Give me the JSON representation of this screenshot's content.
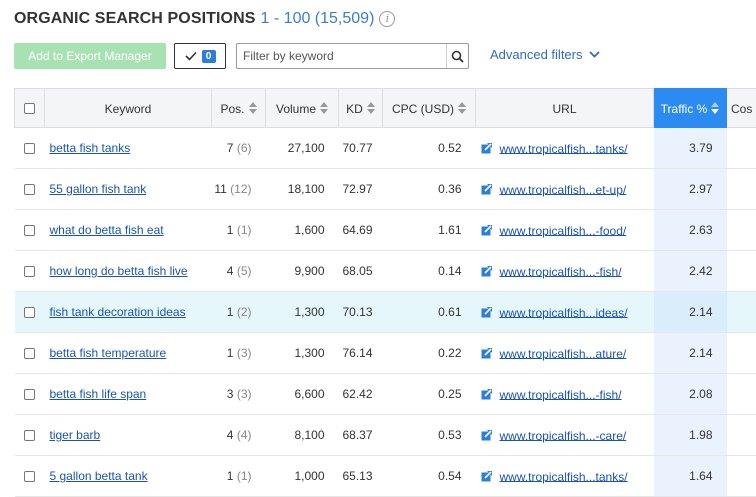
{
  "header": {
    "title": "ORGANIC SEARCH POSITIONS",
    "range": "1 - 100 (15,509)",
    "info_icon": "info-icon"
  },
  "toolbar": {
    "export_label": "Add to Export Manager",
    "selected_count": "0",
    "filter_placeholder": "Filter by keyword",
    "advanced_filters_label": "Advanced filters"
  },
  "colors": {
    "export_button": "#a8e2b2",
    "active_header": "#2b8bf0",
    "link": "#1a54b0",
    "highlight_row": "#e6f7fc"
  },
  "columns": {
    "keyword": "Keyword",
    "pos": "Pos.",
    "volume": "Volume",
    "kd": "KD",
    "cpc": "CPC (USD)",
    "url": "URL",
    "traffic": "Traffic %",
    "cost": "Cos"
  },
  "rows": [
    {
      "keyword": "betta fish tanks",
      "pos": "7",
      "prev": "(6)",
      "volume": "27,100",
      "kd": "70.77",
      "cpc": "0.52",
      "url": "www.tropicalfish...tanks/",
      "traffic": "3.79"
    },
    {
      "keyword": "55 gallon fish tank",
      "pos": "11",
      "prev": "(12)",
      "volume": "18,100",
      "kd": "72.97",
      "cpc": "0.36",
      "url": "www.tropicalfish...et-up/",
      "traffic": "2.97"
    },
    {
      "keyword": "what do betta fish eat",
      "pos": "1",
      "prev": "(1)",
      "volume": "1,600",
      "kd": "64.69",
      "cpc": "1.61",
      "url": "www.tropicalfish...-food/",
      "traffic": "2.63"
    },
    {
      "keyword": "how long do betta fish live",
      "pos": "4",
      "prev": "(5)",
      "volume": "9,900",
      "kd": "68.05",
      "cpc": "0.14",
      "url": "www.tropicalfish...-fish/",
      "traffic": "2.42"
    },
    {
      "keyword": "fish tank decoration ideas",
      "pos": "1",
      "prev": "(2)",
      "volume": "1,300",
      "kd": "70.13",
      "cpc": "0.61",
      "url": "www.tropicalfish...ideas/",
      "traffic": "2.14"
    },
    {
      "keyword": "betta fish temperature",
      "pos": "1",
      "prev": "(3)",
      "volume": "1,300",
      "kd": "76.14",
      "cpc": "0.22",
      "url": "www.tropicalfish...ature/",
      "traffic": "2.14"
    },
    {
      "keyword": "betta fish life span",
      "pos": "3",
      "prev": "(3)",
      "volume": "6,600",
      "kd": "62.42",
      "cpc": "0.25",
      "url": "www.tropicalfish...-fish/",
      "traffic": "2.08"
    },
    {
      "keyword": "tiger barb",
      "pos": "4",
      "prev": "(4)",
      "volume": "8,100",
      "kd": "68.37",
      "cpc": "0.53",
      "url": "www.tropicalfish...-care/",
      "traffic": "1.98"
    },
    {
      "keyword": "5 gallon betta tank",
      "pos": "1",
      "prev": "(1)",
      "volume": "1,000",
      "kd": "65.13",
      "cpc": "0.54",
      "url": "www.tropicalfish...tanks/",
      "traffic": "1.64"
    }
  ]
}
